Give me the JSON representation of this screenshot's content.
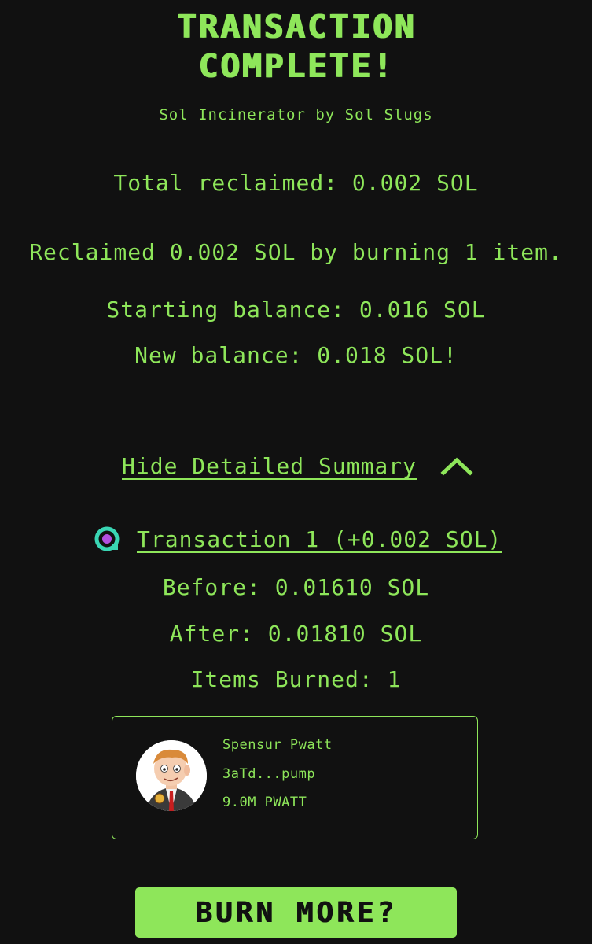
{
  "header": {
    "title_line1": "TRANSACTION",
    "title_line2": "COMPLETE!",
    "subtitle": "Sol Incinerator by Sol Slugs"
  },
  "summary": {
    "total_reclaimed": "Total reclaimed: 0.002 SOL",
    "reclaimed_message": "Reclaimed 0.002 SOL by burning 1 item.",
    "starting_balance": "Starting balance: 0.016 SOL",
    "new_balance": "New balance: 0.018 SOL!"
  },
  "details_toggle": {
    "label": "Hide Detailed Summary",
    "icon": "chevron-up-icon"
  },
  "transactions": [
    {
      "link_label": "Transaction 1 (+0.002 SOL)",
      "icon": "explorer-icon",
      "before": "Before: 0.01610 SOL",
      "after": "After: 0.01810 SOL",
      "items_burned": "Items Burned: 1",
      "tokens": [
        {
          "name": "Spensur Pwatt",
          "mint": "3aTd...pump",
          "amount": "9.0M PWATT"
        }
      ]
    }
  ],
  "actions": {
    "burn_more": "BURN MORE?"
  },
  "colors": {
    "background": "#111111",
    "accent": "#8ee65a",
    "explorer_ring": "#3ad6b4",
    "explorer_dot": "#b24fe0"
  }
}
